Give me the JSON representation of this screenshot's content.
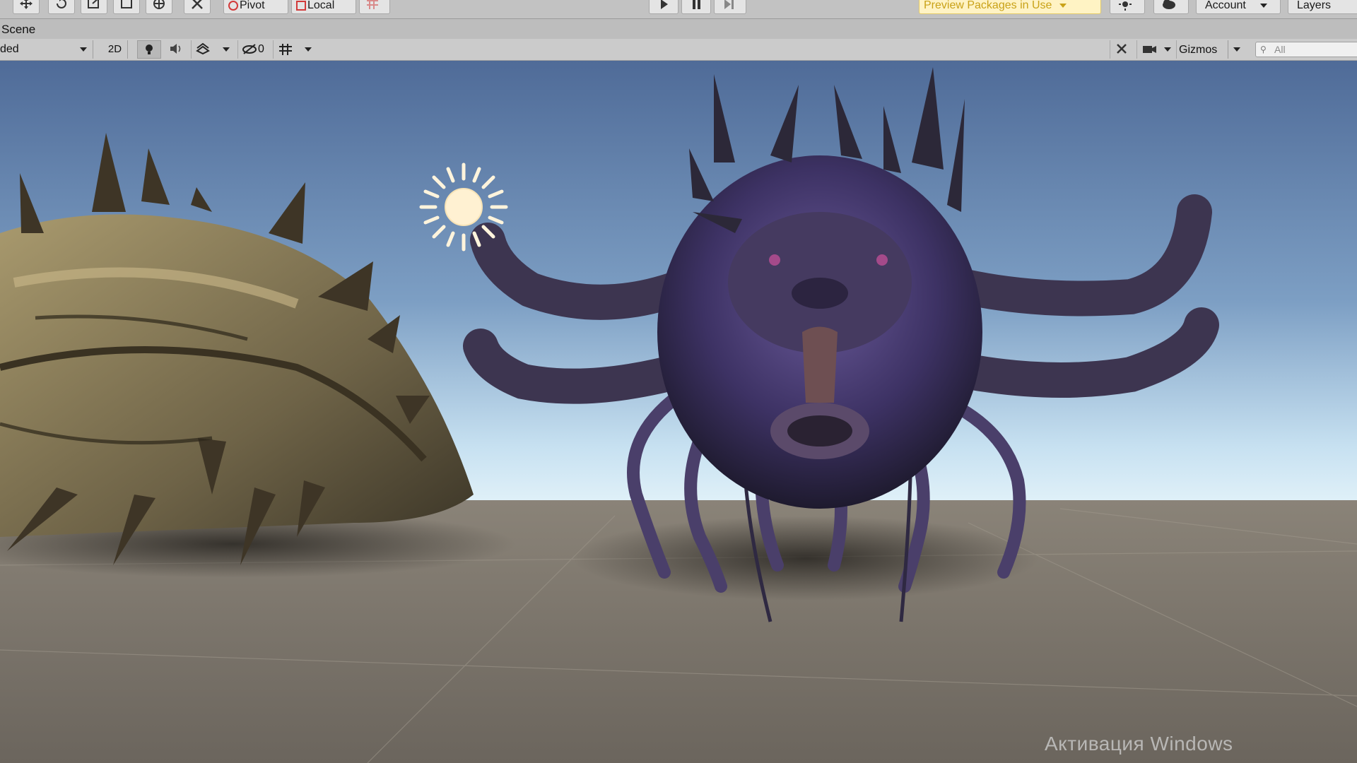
{
  "toolbar": {
    "pivot_label": "Pivot",
    "local_label": "Local",
    "preview_packages_label": "Preview Packages in Use",
    "account_label": "Account",
    "layers_label": "Layers"
  },
  "scene": {
    "tab_label": "Scene",
    "shading_mode_label": "ded",
    "mode_2d_label": "2D",
    "hidden_count": "0",
    "gizmos_label": "Gizmos",
    "search_placeholder": "All"
  },
  "watermark": {
    "text": "Активация Windows"
  },
  "colors": {
    "sky_top": "#4f6b98",
    "sky_horizon": "#d9ecf7",
    "ground": "#7b7467",
    "preview_badge_bg": "#fff3c4",
    "preview_badge_text": "#c9a218"
  },
  "icons": {
    "move_tool": "move-icon",
    "rotate_tool": "rotate-icon",
    "scale_tool": "scale-icon",
    "rect_tool": "rect-icon",
    "transform_tool": "transform-icon",
    "custom_tool": "tools-icon",
    "play": "play-icon",
    "pause": "pause-icon",
    "step": "step-icon",
    "light_gizmo": "sun-icon"
  }
}
